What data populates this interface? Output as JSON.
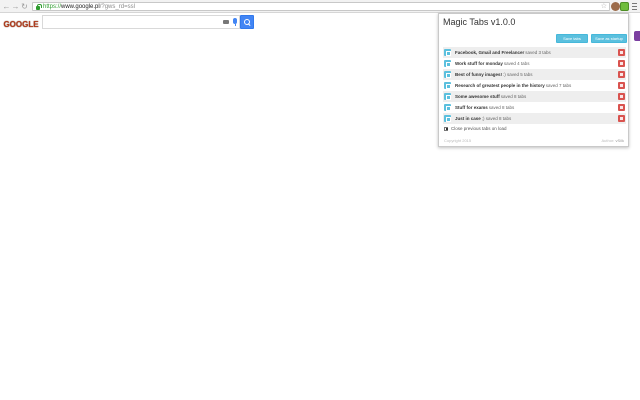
{
  "browser": {
    "url_scheme": "https://",
    "url_host": "www.google.pl",
    "url_path": "/?gws_rd=ssl"
  },
  "google": {
    "doodle_text": "GOOGLE",
    "search_value": ""
  },
  "extension": {
    "title": "Magic Tabs v1.0.0",
    "save_tabs_label": "Save tabs",
    "save_startup_label": "Save as startup",
    "sessions": [
      {
        "name": "Facebook, Gmail and Freelancer",
        "meta": "saved 3 tabs"
      },
      {
        "name": "Work stuff for monday",
        "meta": "saved 4 tabs"
      },
      {
        "name": "Best of funny images!",
        "meta": ":) saved 5 tabs"
      },
      {
        "name": "Research of greatest people in the history",
        "meta": "saved 7 tabs"
      },
      {
        "name": "Some awesome stuff",
        "meta": "saved 8 tabs"
      },
      {
        "name": "Stuff for exams",
        "meta": "saved 8 tabs"
      },
      {
        "name": "Just in case",
        "meta": ";) saved 8 tabs"
      }
    ],
    "close_previous_label": "Close previous tabs on load",
    "footer_left": "Copyright 2015",
    "footer_author_prefix": "Author:",
    "footer_author": "vSilk"
  },
  "colors": {
    "accent": "#5bc0de",
    "danger": "#d9534f",
    "google_blue": "#4285f4"
  }
}
